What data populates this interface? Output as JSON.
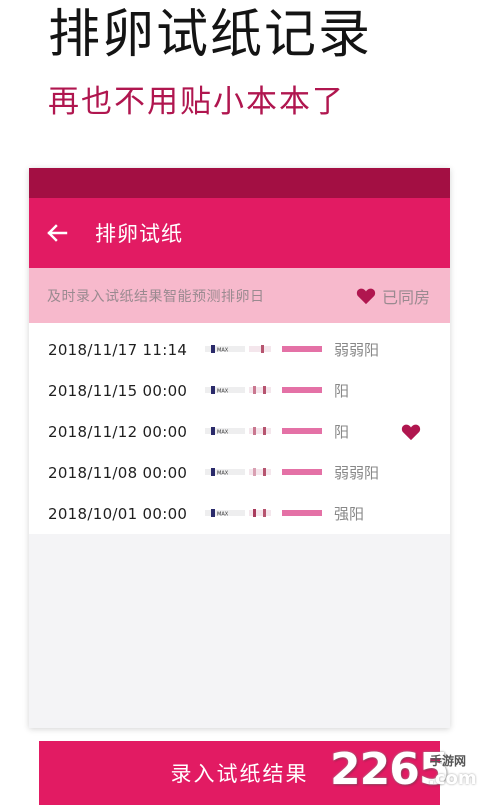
{
  "promo": {
    "headline": "排卵试纸记录",
    "subline": "再也不用贴小本本了"
  },
  "appbar": {
    "back_icon": "arrow-left-icon",
    "title": "排卵试纸"
  },
  "info_bar": {
    "text": "及时录入试纸结果智能预测排卵日",
    "had_sex_label": "已同房",
    "had_sex_icon": "heart-icon"
  },
  "strip_label": "MAX",
  "records": [
    {
      "date": "2018/11/17 11:14",
      "result": "弱弱阳",
      "heart": false
    },
    {
      "date": "2018/11/15 00:00",
      "result": "阳",
      "heart": false
    },
    {
      "date": "2018/11/12 00:00",
      "result": "阳",
      "heart": true
    },
    {
      "date": "2018/11/08 00:00",
      "result": "弱弱阳",
      "heart": false
    },
    {
      "date": "2018/10/01 00:00",
      "result": "强阳",
      "heart": false
    }
  ],
  "cta": {
    "label": "录入试纸结果"
  },
  "watermark": {
    "number": "2265",
    "domain": ".com",
    "site": "手游网"
  },
  "colors": {
    "primary": "#e21b63",
    "primary_dark": "#a30f43",
    "info_bg": "#f7b9cc",
    "heart": "#b0164f",
    "strip_line": "#e471a6"
  }
}
